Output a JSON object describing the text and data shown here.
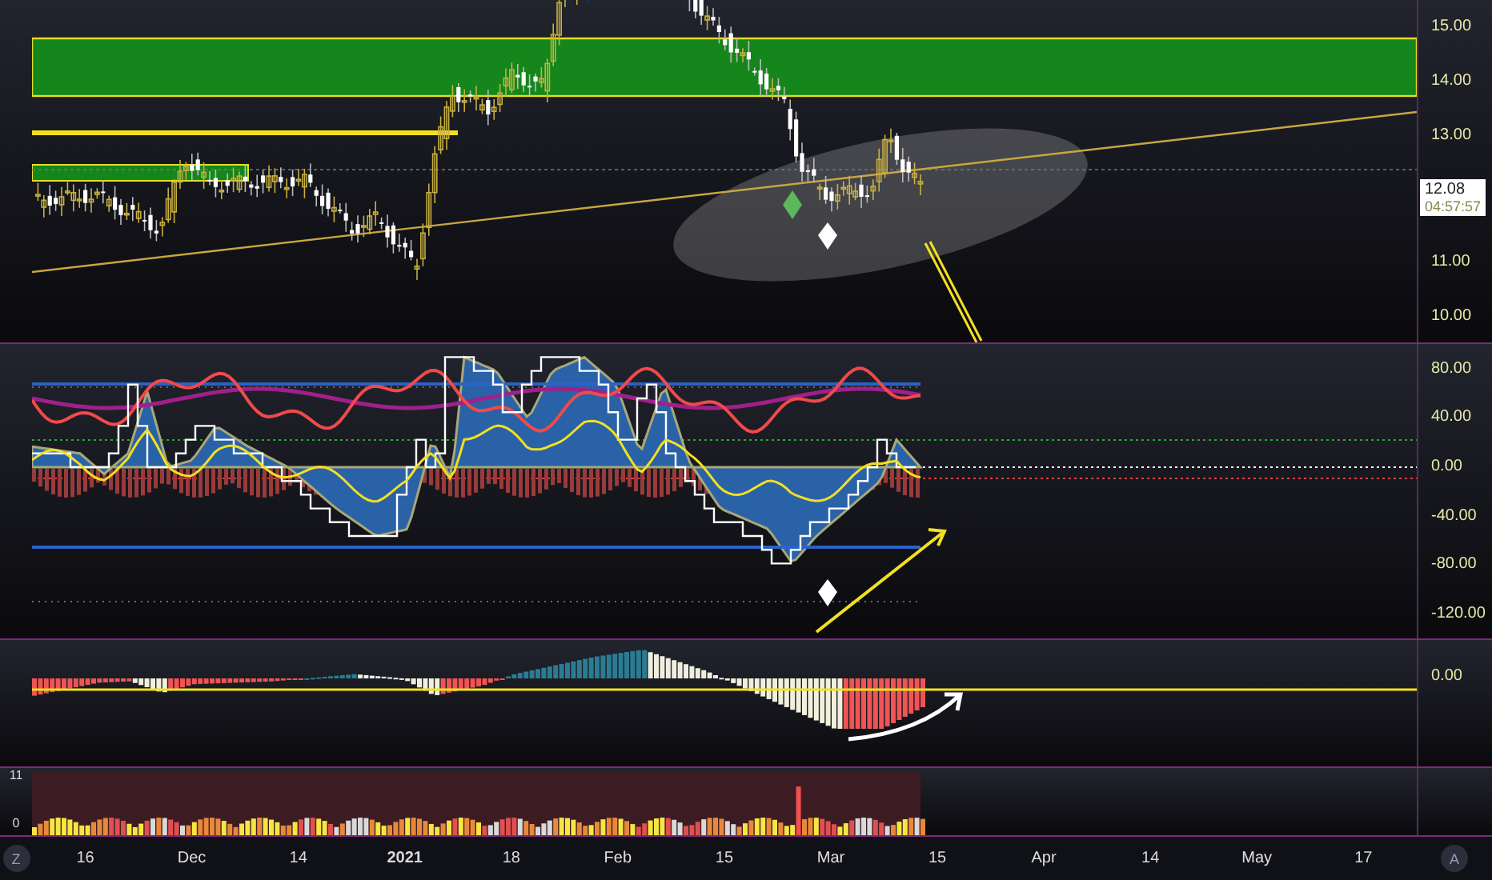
{
  "price_axis": {
    "ticks": [
      "15.00",
      "14.00",
      "13.00",
      "11.00",
      "10.00"
    ],
    "last_price": "12.08",
    "countdown": "04:57:57"
  },
  "oscillator_axis": {
    "ticks": [
      "80.00",
      "40.00",
      "0.00",
      "-40.00",
      "-80.00",
      "-120.00"
    ]
  },
  "histogram_axis": {
    "ticks": [
      "0.00"
    ]
  },
  "volume_axis": {
    "ticks": [
      "11",
      "0"
    ]
  },
  "time_axis": {
    "labels": [
      {
        "text": "16",
        "kind": "day"
      },
      {
        "text": "Dec",
        "kind": "month"
      },
      {
        "text": "14",
        "kind": "day"
      },
      {
        "text": "2021",
        "kind": "year"
      },
      {
        "text": "18",
        "kind": "day"
      },
      {
        "text": "Feb",
        "kind": "month"
      },
      {
        "text": "15",
        "kind": "day"
      },
      {
        "text": "Mar",
        "kind": "month"
      },
      {
        "text": "15",
        "kind": "day"
      },
      {
        "text": "Apr",
        "kind": "month"
      },
      {
        "text": "14",
        "kind": "day"
      },
      {
        "text": "May",
        "kind": "month"
      },
      {
        "text": "17",
        "kind": "day"
      }
    ]
  },
  "buttons": {
    "left": "Z",
    "right": "A"
  }
}
